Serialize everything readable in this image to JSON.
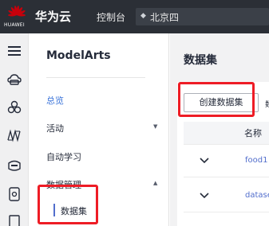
{
  "header": {
    "logo_text": "HUAWEI",
    "brand": "华为云",
    "console": "控制台",
    "region": "北京四",
    "colors": {
      "bar": "#2b2f36",
      "logo": "#c7000b"
    }
  },
  "rail": {
    "icons": [
      "menu-icon",
      "cloud-drive-icon",
      "cluster-icon",
      "mesh-icon",
      "storage-icon",
      "device-icon",
      "doc-icon"
    ]
  },
  "nav": {
    "title": "ModelArts",
    "items": [
      {
        "label": "总览",
        "active": true
      },
      {
        "label": "活动",
        "expandable": true
      },
      {
        "label": "自动学习"
      },
      {
        "label": "数据管理",
        "expandable": true,
        "expanded": true
      }
    ],
    "sub_items": [
      {
        "label": "数据集",
        "active": true
      }
    ]
  },
  "main": {
    "title": "数据集",
    "create_button": "创建数据集",
    "partial_char": "数",
    "table": {
      "columns": [
        "名称"
      ],
      "rows": [
        {
          "name": "food1"
        },
        {
          "name": "datase"
        }
      ]
    }
  },
  "highlight_color": "#ee1c25"
}
